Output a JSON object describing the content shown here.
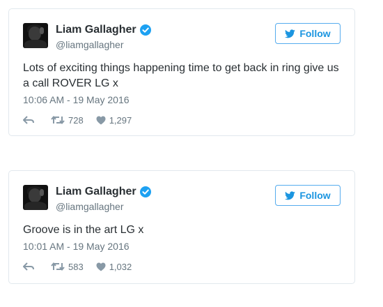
{
  "colors": {
    "accent": "#1b95e0",
    "border": "#e1e8ed",
    "muted": "#66757f",
    "text": "#292f33",
    "verified": "#1da1f2"
  },
  "tweets": [
    {
      "author_name": "Liam Gallagher",
      "handle": "@liamgallagher",
      "follow_label": "Follow",
      "text": "Lots of exciting things happening time to get back in ring give us a call ROVER LG x",
      "timestamp": "10:06 AM - 19 May 2016",
      "retweets": "728",
      "likes": "1,297",
      "icons": [
        "verified-badge-icon",
        "twitter-bird-icon",
        "reply-icon",
        "retweet-icon",
        "heart-icon"
      ]
    },
    {
      "author_name": "Liam Gallagher",
      "handle": "@liamgallagher",
      "follow_label": "Follow",
      "text": "Groove is in the art LG x",
      "timestamp": "10:01 AM - 19 May 2016",
      "retweets": "583",
      "likes": "1,032",
      "icons": [
        "verified-badge-icon",
        "twitter-bird-icon",
        "reply-icon",
        "retweet-icon",
        "heart-icon"
      ]
    }
  ]
}
